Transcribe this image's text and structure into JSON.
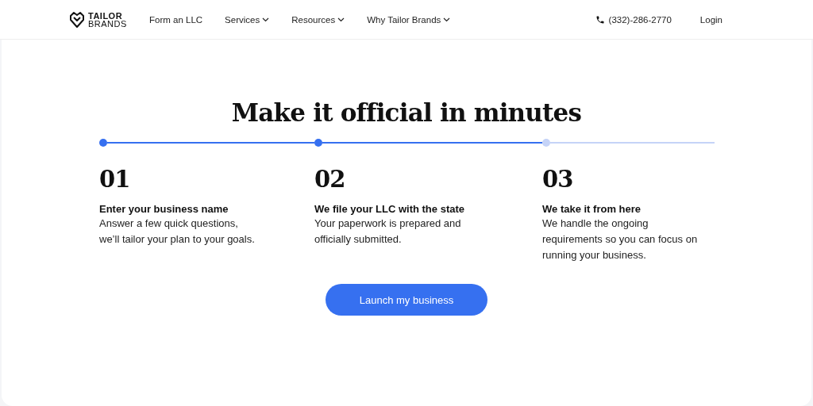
{
  "logo": {
    "top": "TAILOR",
    "bottom": "BRANDS"
  },
  "nav": [
    {
      "label": "Form an LLC",
      "dropdown": false
    },
    {
      "label": "Services",
      "dropdown": true
    },
    {
      "label": "Resources",
      "dropdown": true
    },
    {
      "label": "Why Tailor Brands",
      "dropdown": true
    }
  ],
  "phone": "(332)-286-2770",
  "login": "Login",
  "heading": "Make it official in minutes",
  "steps": [
    {
      "number": "01",
      "title": "Enter your business name",
      "text": "Answer a few quick questions, we’ll tailor your plan to your goals.",
      "completed": true
    },
    {
      "number": "02",
      "title": "We file your LLC with the state",
      "text": "Your paperwork is prepared and officially submitted.",
      "completed": true
    },
    {
      "number": "03",
      "title": "We take it from here",
      "text": "We handle the ongoing requirements so you can focus on running your business.",
      "completed": false
    }
  ],
  "cta": "Launch my business"
}
